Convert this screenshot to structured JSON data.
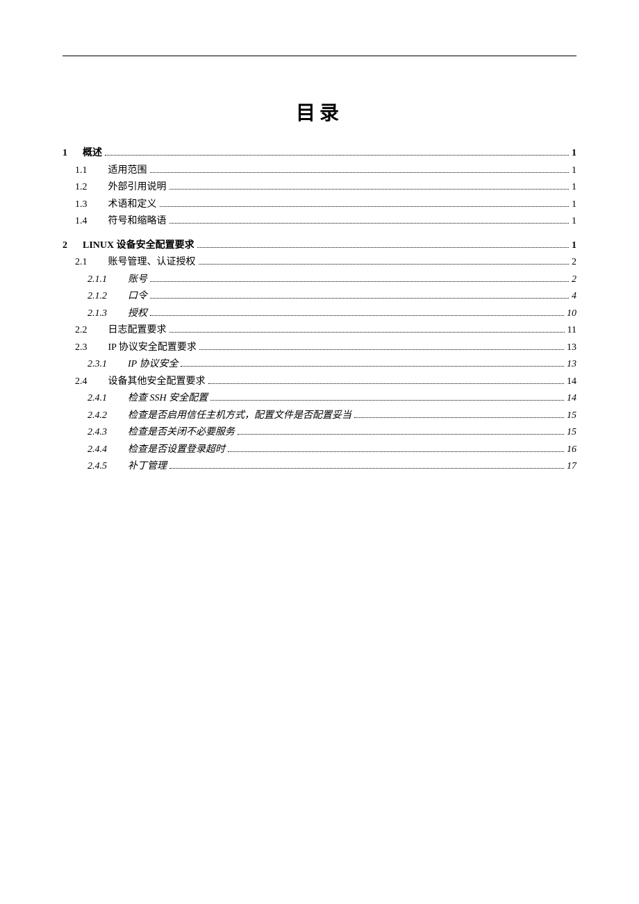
{
  "title": "目录",
  "toc": [
    {
      "level": 1,
      "num": "1",
      "label": "概述",
      "page": "1"
    },
    {
      "level": 2,
      "num": "1.1",
      "label": "适用范围",
      "page": "1"
    },
    {
      "level": 2,
      "num": "1.2",
      "label": "外部引用说明",
      "page": "1"
    },
    {
      "level": 2,
      "num": "1.3",
      "label": "术语和定义",
      "page": "1"
    },
    {
      "level": 2,
      "num": "1.4",
      "label": "符号和缩略语",
      "page": "1"
    },
    {
      "level": 1,
      "num": "2",
      "label": "LINUX 设备安全配置要求",
      "page": "1"
    },
    {
      "level": 2,
      "num": "2.1",
      "label": "账号管理、认证授权",
      "page": "2"
    },
    {
      "level": 3,
      "num": "2.1.1",
      "label": "账号",
      "page": "2"
    },
    {
      "level": 3,
      "num": "2.1.2",
      "label": "口令",
      "page": "4"
    },
    {
      "level": 3,
      "num": "2.1.3",
      "label": "授权",
      "page": "10"
    },
    {
      "level": 2,
      "num": "2.2",
      "label": "日志配置要求",
      "page": "11"
    },
    {
      "level": 2,
      "num": "2.3",
      "label": "IP 协议安全配置要求",
      "page": "13"
    },
    {
      "level": 3,
      "num": "2.3.1",
      "label": "IP 协议安全",
      "page": "13"
    },
    {
      "level": 2,
      "num": "2.4",
      "label": "设备其他安全配置要求",
      "page": "14"
    },
    {
      "level": 3,
      "num": "2.4.1",
      "label": "检查 SSH 安全配置",
      "page": "14"
    },
    {
      "level": 3,
      "num": "2.4.2",
      "label": "检查是否启用信任主机方式，配置文件是否配置妥当",
      "page": "15"
    },
    {
      "level": 3,
      "num": "2.4.3",
      "label": "检查是否关闭不必要服务",
      "page": "15"
    },
    {
      "level": 3,
      "num": "2.4.4",
      "label": "检查是否设置登录超时",
      "page": "16"
    },
    {
      "level": 3,
      "num": "2.4.5",
      "label": "补丁管理",
      "page": "17"
    }
  ]
}
